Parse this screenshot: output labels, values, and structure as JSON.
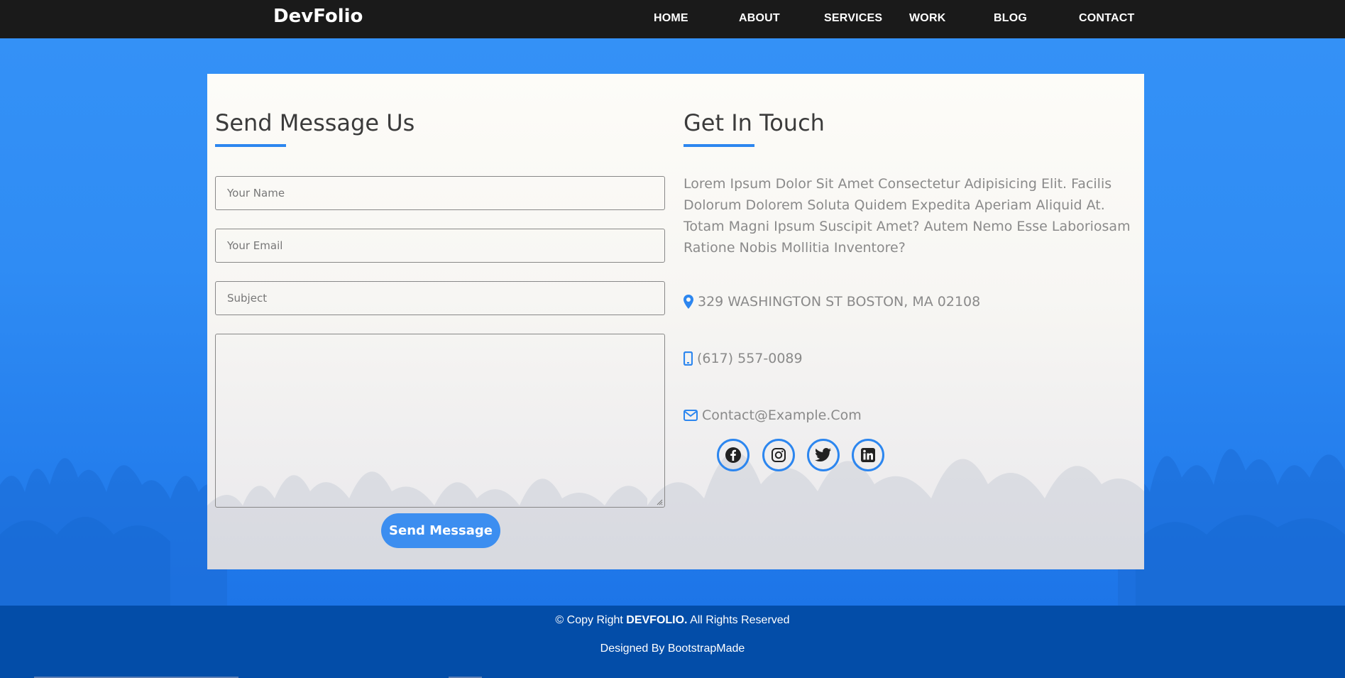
{
  "navbar": {
    "brand": "DevFolio",
    "links": [
      "HOME",
      "ABOUT",
      "SERVICES",
      "WORK",
      "BLOG",
      "CONTACT"
    ]
  },
  "form": {
    "title": "Send Message Us",
    "name_placeholder": "Your Name",
    "email_placeholder": "Your Email",
    "subject_placeholder": "Subject",
    "message_value": "",
    "send_label": "Send Message"
  },
  "contact": {
    "title": "Get In Touch",
    "description": "Lorem Ipsum Dolor Sit Amet Consectetur Adipisicing Elit. Facilis Dolorum Dolorem Soluta Quidem Expedita Aperiam Aliquid At. Totam Magni Ipsum Suscipit Amet? Autem Nemo Esse Laboriosam Ratione Nobis Mollitia Inventore?",
    "address": "329 WASHINGTON ST BOSTON, MA 02108",
    "phone": "(617) 557-0089",
    "email": "Contact@Example.Com",
    "social": [
      "facebook-icon",
      "instagram-icon",
      "twitter-icon",
      "linkedin-icon"
    ]
  },
  "footer": {
    "copyright_prefix": "© Copy Right",
    "brand": "DEVFOLIO.",
    "copyright_suffix": "All Rights Reserved",
    "designed_by": "Designed By BootstrapMade"
  },
  "colors": {
    "accent": "#2c86ef",
    "navbar": "#1a1a1a",
    "footer": "#034da8",
    "button": "#3c8ef0"
  }
}
